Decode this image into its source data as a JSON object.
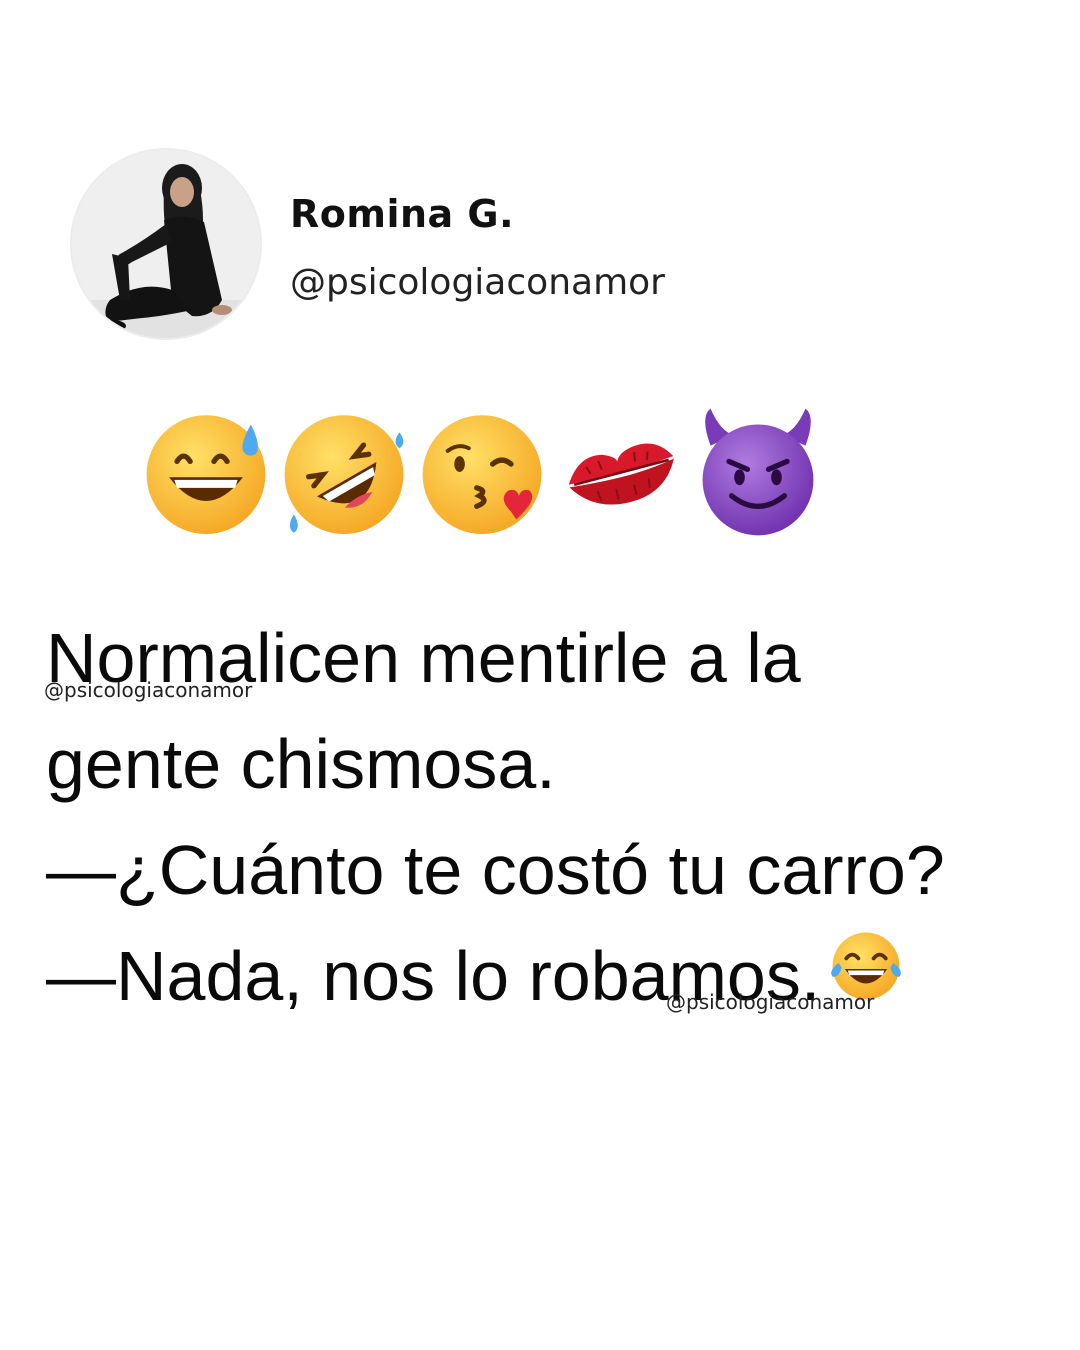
{
  "profile": {
    "display_name": "Romina G.",
    "handle": "@psicologiaconamor",
    "avatar": "person-sitting-photo"
  },
  "emojis": [
    "grinning-sweat-emoji",
    "rolling-laughing-emoji",
    "kiss-heart-emoji",
    "kiss-mark-emoji",
    "smiling-devil-emoji"
  ],
  "post": {
    "lines": [
      "Normalicen mentirle a la",
      "gente chismosa.",
      "—¿Cuánto te costó tu carro?",
      "—Nada, nos lo robamos."
    ],
    "trailing_emoji": "tears-of-joy-emoji"
  },
  "watermarks": [
    "@psicologiaconamor",
    "@psicologiaconamor"
  ],
  "colors": {
    "emoji_yellow": "#FFC83D",
    "devil_purple": "#8E4BC9",
    "lips_red": "#D7192B",
    "text": "#0a0a0a"
  }
}
